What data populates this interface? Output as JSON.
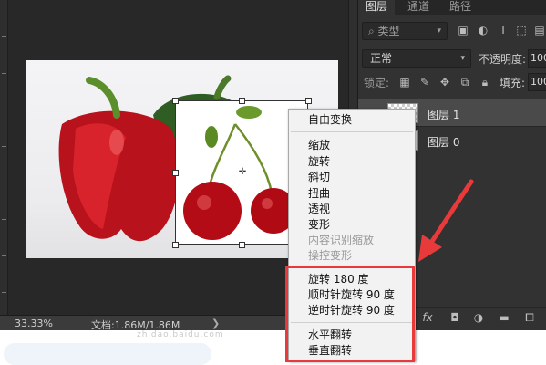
{
  "canvas": {
    "zoom": "33.33%",
    "doc_info": "文档:1.86M/1.86M",
    "nav_arrow": "❯"
  },
  "watermark": "zhidao.baidu.com",
  "layers_panel": {
    "tabs": [
      "图层",
      "通道",
      "路径"
    ],
    "filter_kind": "类型",
    "blend_mode": "正常",
    "opacity_label": "不透明度:",
    "opacity_value": "100",
    "lock_label": "锁定:",
    "fill_label": "填充:",
    "fill_value": "100",
    "layers": [
      {
        "name": "图层 1",
        "selected": true
      },
      {
        "name": "图层 0",
        "selected": false
      }
    ]
  },
  "context_menu": {
    "items": [
      {
        "label": "自由变换",
        "disabled": false
      },
      {
        "label": "缩放",
        "disabled": false
      },
      {
        "label": "旋转",
        "disabled": false
      },
      {
        "label": "斜切",
        "disabled": false
      },
      {
        "label": "扭曲",
        "disabled": false
      },
      {
        "label": "透视",
        "disabled": false
      },
      {
        "label": "变形",
        "disabled": false
      },
      {
        "label": "内容识别缩放",
        "disabled": true
      },
      {
        "label": "操控变形",
        "disabled": true
      },
      {
        "label": "旋转 180 度",
        "disabled": false
      },
      {
        "label": "顺时针旋转 90 度",
        "disabled": false
      },
      {
        "label": "逆时针旋转 90 度",
        "disabled": false
      },
      {
        "label": "水平翻转",
        "disabled": false
      },
      {
        "label": "垂直翻转",
        "disabled": false
      }
    ]
  },
  "colors": {
    "highlight": "#e83a3a",
    "panel": "#323232",
    "menu_bg": "#f2f2f2"
  }
}
